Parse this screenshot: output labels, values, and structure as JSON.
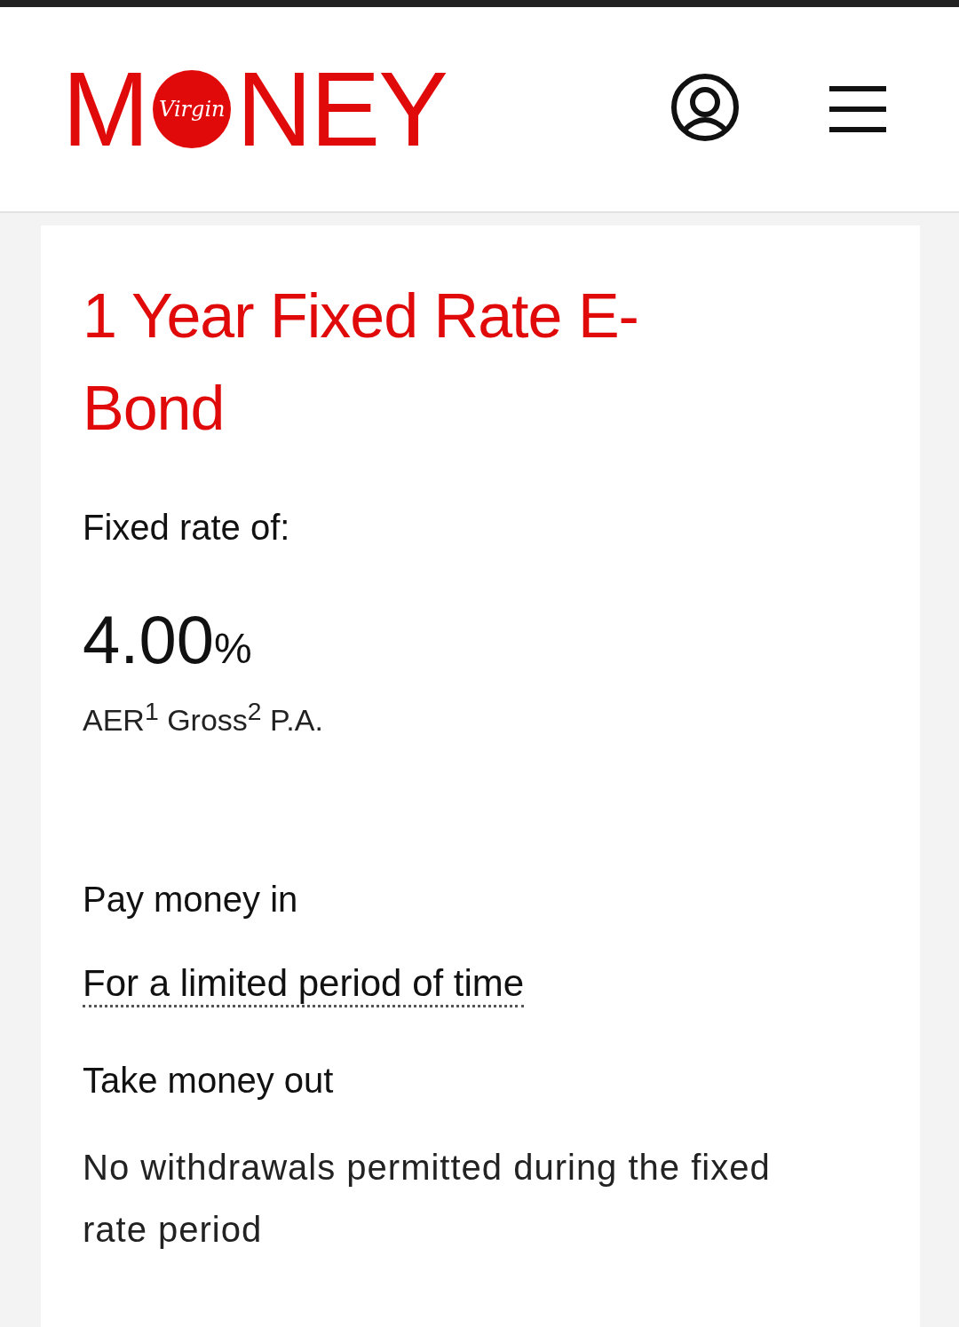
{
  "header": {
    "logo": {
      "before": "M",
      "badge": "Virgin",
      "after": "NEY"
    }
  },
  "card": {
    "title": "1 Year Fixed Rate E-Bond",
    "rate_label": "Fixed rate of:",
    "rate": "4.00",
    "rate_unit": "%",
    "rate_note": "AER$^{1}$ Gross$^{2}$ P.A.",
    "sections": [
      {
        "heading": "Pay money in",
        "kind": "link",
        "text": "For a limited period of time"
      },
      {
        "heading": "Take money out",
        "kind": "plain",
        "text": "No withdrawals permitted during the fixed rate period"
      }
    ]
  }
}
